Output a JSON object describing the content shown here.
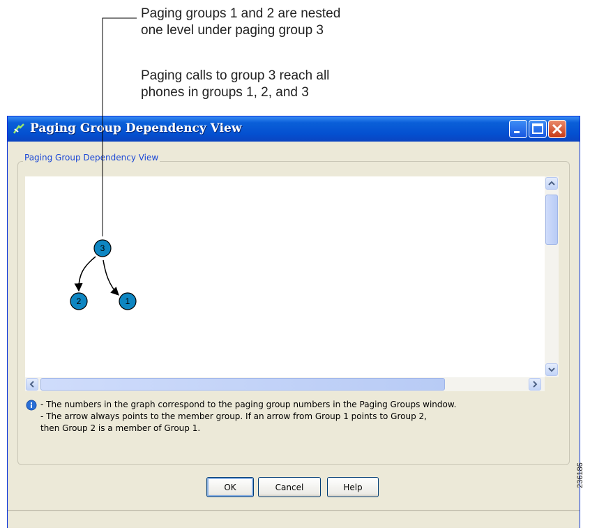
{
  "callout": {
    "line1": "Paging groups 1 and 2 are nested",
    "line2": "one level under paging group 3",
    "line3": "Paging calls to group 3 reach all",
    "line4": "phones in groups 1, 2, and 3"
  },
  "window": {
    "title": "Paging Group Dependency View",
    "group_label": "Paging Group Dependency View",
    "titlebar_color": "#0a5fd8",
    "close_color": "#c73a17"
  },
  "graph": {
    "node_color": "#0e86c2",
    "nodes": [
      {
        "id": "3",
        "label": "3"
      },
      {
        "id": "2",
        "label": "2"
      },
      {
        "id": "1",
        "label": "1"
      }
    ],
    "edges": [
      {
        "from": "3",
        "to": "2"
      },
      {
        "from": "3",
        "to": "1"
      }
    ]
  },
  "info": {
    "icon": "info-icon",
    "line1": "- The numbers in the graph correspond to the paging group numbers in the Paging Groups window.",
    "line2": "- The arrow always points to the member group. If an arrow from Group 1 points to Group 2,",
    "line3": "then Group 2 is a member of Group 1."
  },
  "buttons": {
    "ok": "OK",
    "cancel": "Cancel",
    "help": "Help"
  },
  "figure_id": "236186"
}
